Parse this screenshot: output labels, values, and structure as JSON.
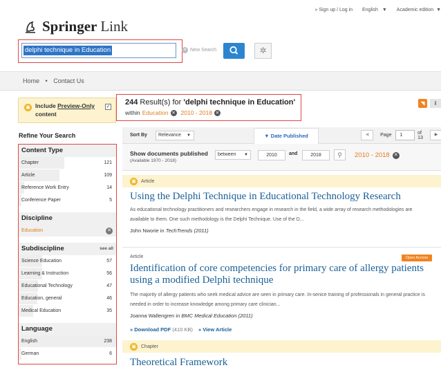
{
  "header": {
    "logo_bold": "Springer",
    "logo_light": "Link",
    "sign_up": "» Sign up / Log in",
    "language": "English",
    "edition": "Academic edition",
    "search_value": "delphi technique in Education",
    "new_search": "New Search"
  },
  "nav": {
    "home": "Home",
    "sep": "•",
    "contact": "Contact Us"
  },
  "preview": {
    "label_pre": "Include ",
    "label_link": "Preview-Only",
    "label_post": "content"
  },
  "refine_title": "Refine Your Search",
  "facets": {
    "content_type": {
      "title": "Content Type",
      "items": [
        {
          "label": "Chapter",
          "count": "121",
          "frac": 0.47
        },
        {
          "label": "Article",
          "count": "109",
          "frac": 0.42
        },
        {
          "label": "Reference Work Entry",
          "count": "14",
          "frac": 0.06
        },
        {
          "label": "Conference Paper",
          "count": "5",
          "frac": 0.03
        }
      ]
    },
    "discipline": {
      "title": "Discipline",
      "active": "Education"
    },
    "subdiscipline": {
      "title": "Subdiscipline",
      "see_all": "see all",
      "items": [
        {
          "label": "Science Education",
          "count": "57",
          "frac": 0.24
        },
        {
          "label": "Learning & Instruction",
          "count": "56",
          "frac": 0.24
        },
        {
          "label": "Educational Technology",
          "count": "47",
          "frac": 0.2
        },
        {
          "label": "Education, general",
          "count": "46",
          "frac": 0.19
        },
        {
          "label": "Medical Education",
          "count": "35",
          "frac": 0.15
        }
      ]
    },
    "language": {
      "title": "Language",
      "items": [
        {
          "label": "English",
          "count": "238",
          "frac": 1.0
        },
        {
          "label": "German",
          "count": "6",
          "frac": 0.03
        }
      ]
    }
  },
  "results": {
    "count": "244",
    "for_text": " Result(s) for ",
    "query": "'delphi technique in Education'",
    "within": "within",
    "filter1": "Education",
    "filter2": "2010 - 2018"
  },
  "sort": {
    "label": "Sort By",
    "value": "Relevance",
    "date_published": "▼ Date Published",
    "page_label": "Page",
    "page_value": "1",
    "of": "of 13"
  },
  "show": {
    "label": "Show documents published",
    "available": "(Available 1970 - 2018)",
    "mode": "between",
    "from": "2010",
    "and": "and",
    "to": "2018",
    "range": "2010 - 2018"
  },
  "items": [
    {
      "type": "Article",
      "title": "Using the Delphi Technique in Educational Technology Research",
      "snippet": "As educational technology practitioners and researchers engage in research in the field, a wide array of research methodologies are available to them. One such methodology is the Delphi Technique. Use of the D...",
      "author": "John Nworie in ",
      "journal": "TechTrends (2011)"
    },
    {
      "type": "Article",
      "badge": "Open Access",
      "title": "Identification of core competencies for primary care of allergy patients using a modified Delphi technique",
      "snippet": "The majority of allergy patients who seek medical advice are seen in primary care. In-senice training of professionals in general practice is needed in order to increase knowledge among primary care clinician...",
      "author": "Joanna Wallengren in ",
      "journal": "BMC Medical Education (2011)",
      "download": "» Download PDF",
      "size": " (410 KB)",
      "view": "» View Article"
    },
    {
      "type": "Chapter",
      "title": "Theoretical Framework"
    }
  ]
}
